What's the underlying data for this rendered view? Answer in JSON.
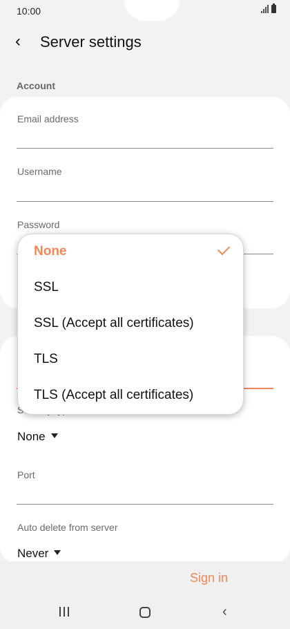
{
  "status": {
    "time": "10:00"
  },
  "header": {
    "title": "Server settings"
  },
  "account_section": {
    "label": "Account"
  },
  "fields": {
    "email_label": "Email address",
    "username_label": "Username",
    "password_label": "Password",
    "security_type_label": "Security type",
    "security_type_value": "None",
    "port_label": "Port",
    "auto_delete_label": "Auto delete from server",
    "auto_delete_value": "Never"
  },
  "dropdown": {
    "options": [
      {
        "label": "None",
        "selected": true
      },
      {
        "label": "SSL",
        "selected": false
      },
      {
        "label": "SSL (Accept all certificates)",
        "selected": false
      },
      {
        "label": "TLS",
        "selected": false
      },
      {
        "label": "TLS (Accept all certificates)",
        "selected": false
      }
    ]
  },
  "footer": {
    "sign_in_label": "Sign in"
  },
  "colors": {
    "accent": "#ef8857",
    "background": "#f2f2f2",
    "card": "#ffffff"
  }
}
